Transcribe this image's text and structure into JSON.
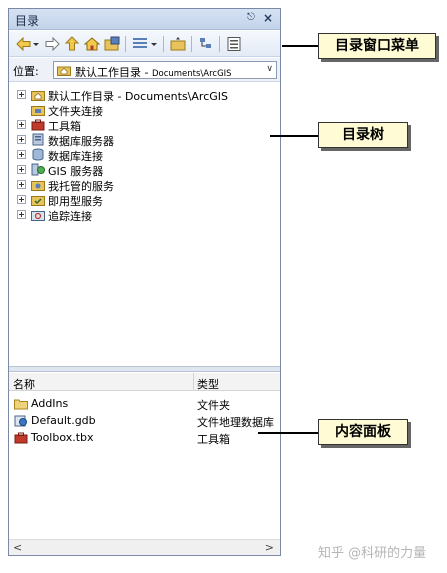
{
  "window": {
    "title": "目录",
    "pin_glyph": "←",
    "close_glyph": "×"
  },
  "toolbar": {
    "icons": [
      "back-icon",
      "dropdown-arrow-icon",
      "forward-icon",
      "up-level-icon",
      "home-icon",
      "connect-folder-icon",
      "view-options-icon",
      "new-item-icon",
      "tree-toggle-icon",
      "list-view-icon"
    ]
  },
  "location": {
    "label": "位置:",
    "value_main": "默认工作目录 - ",
    "value_path": "Documents\\ArcGIS",
    "dropdown_glyph": "∨"
  },
  "tree": {
    "items": [
      {
        "label": "默认工作目录 - Documents\\ArcGIS",
        "icon": "home-folder-icon",
        "expander": true
      },
      {
        "label": "文件夹连接",
        "icon": "folder-connection-icon",
        "expander": false
      },
      {
        "label": "工具箱",
        "icon": "toolbox-icon",
        "expander": true
      },
      {
        "label": "数据库服务器",
        "icon": "database-server-icon",
        "expander": true
      },
      {
        "label": "数据库连接",
        "icon": "database-connection-icon",
        "expander": true
      },
      {
        "label": "GIS 服务器",
        "icon": "gis-server-icon",
        "expander": true
      },
      {
        "label": "我托管的服务",
        "icon": "hosted-services-icon",
        "expander": true
      },
      {
        "label": "即用型服务",
        "icon": "ready-services-icon",
        "expander": true
      },
      {
        "label": "追踪连接",
        "icon": "tracking-connection-icon",
        "expander": true
      }
    ]
  },
  "contents": {
    "col_name": "名称",
    "col_type": "类型",
    "rows": [
      {
        "name": "AddIns",
        "type": "文件夹",
        "icon": "folder-icon"
      },
      {
        "name": "Default.gdb",
        "type": "文件地理数据库",
        "icon": "geodatabase-icon"
      },
      {
        "name": "Toolbox.tbx",
        "type": "工具箱",
        "icon": "toolbox-icon"
      }
    ],
    "scroll_left": "<",
    "scroll_right": ">"
  },
  "callouts": {
    "menu": "目录窗口菜单",
    "tree": "目录树",
    "panel": "内容面板"
  },
  "watermark": "知乎 @科研的力量",
  "colors": {
    "title_bar": "#c9d8ee",
    "callout_bg": "#fffbd4",
    "folder": "#e8c25a"
  }
}
